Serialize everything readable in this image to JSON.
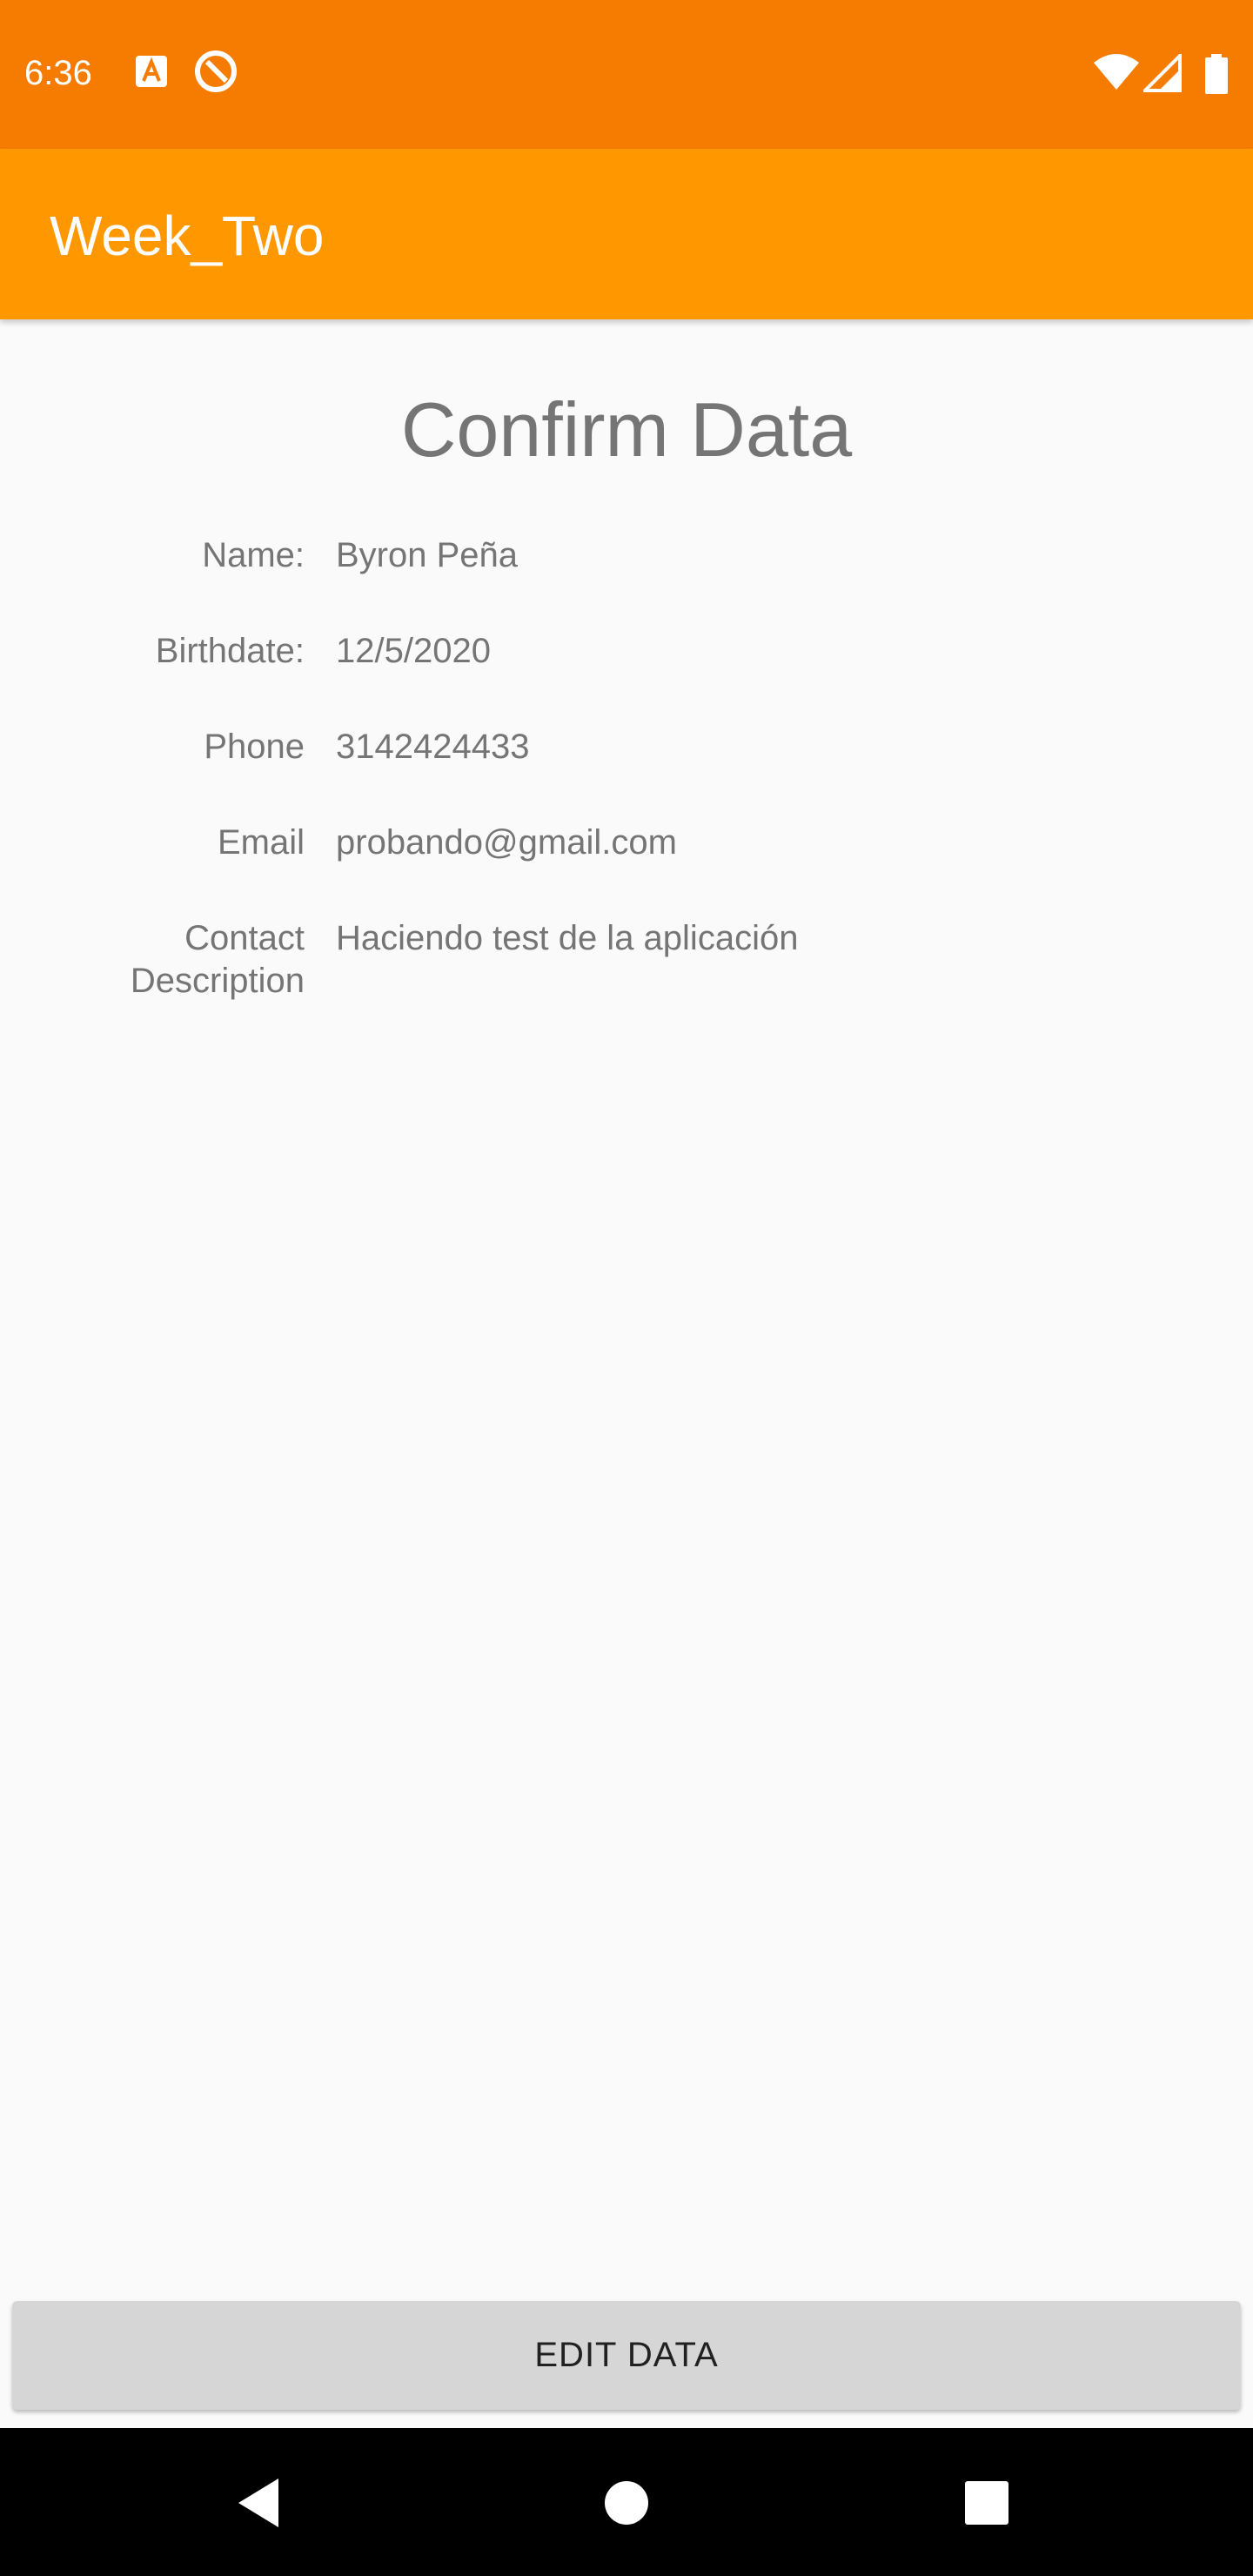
{
  "status_bar": {
    "time": "6:36",
    "icons": [
      "text-format-notification-icon",
      "do-not-disturb-notification-icon",
      "wifi-icon",
      "cell-signal-icon",
      "battery-icon"
    ]
  },
  "app_bar": {
    "title": "Week_Two"
  },
  "main": {
    "title": "Confirm Data",
    "fields": [
      {
        "label": "Name:",
        "value": "Byron Peña"
      },
      {
        "label": "Birthdate:",
        "value": "12/5/2020"
      },
      {
        "label": "Phone",
        "value": "3142424433"
      },
      {
        "label": "Email",
        "value": "probando@gmail.com"
      },
      {
        "label": "Contact Description",
        "label_lines": [
          "Contact",
          "Description"
        ],
        "value": "Haciendo test de la aplicación"
      }
    ],
    "edit_button_label": "EDIT DATA"
  },
  "nav_bar": {
    "buttons": [
      "back-icon",
      "home-icon",
      "recents-icon"
    ]
  },
  "colors": {
    "status_bar": "#f57c00",
    "app_bar": "#ff9800",
    "background": "#fafafa",
    "text": "#757575",
    "button": "#d6d6d6",
    "nav_bar": "#000000"
  }
}
